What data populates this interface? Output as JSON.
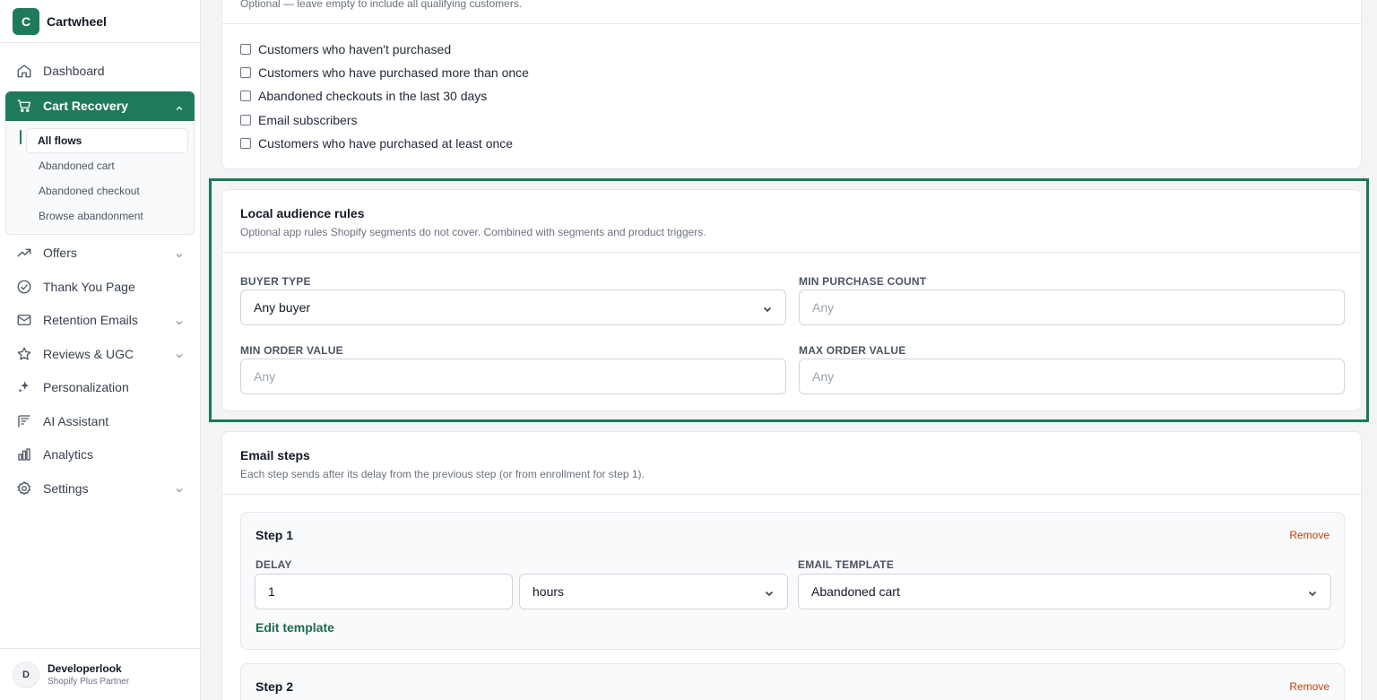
{
  "brand": {
    "logo_letter": "C",
    "name": "Cartwheel",
    "color": "#1f7a5c"
  },
  "sidebar": {
    "items": [
      {
        "label": "Dashboard",
        "icon": "home-icon"
      },
      {
        "label": "Cart Recovery",
        "icon": "cart-icon",
        "active": true
      },
      {
        "label": "Offers",
        "icon": "trending-up-icon"
      },
      {
        "label": "Thank You Page",
        "icon": "check-circle-icon"
      },
      {
        "label": "Retention Emails",
        "icon": "mail-icon"
      },
      {
        "label": "Reviews & UGC",
        "icon": "star-icon"
      },
      {
        "label": "Personalization",
        "icon": "sparkle-icon"
      },
      {
        "label": "AI Assistant",
        "icon": "ai-icon"
      },
      {
        "label": "Analytics",
        "icon": "bar-chart-icon"
      },
      {
        "label": "Settings",
        "icon": "gear-icon"
      }
    ],
    "sub_items": [
      "All flows",
      "Abandoned cart",
      "Abandoned checkout",
      "Browse abandonment"
    ]
  },
  "user": {
    "initial": "D",
    "name": "Developerlook",
    "role": "Shopify Plus Partner"
  },
  "segments": {
    "note": "Optional — leave empty to include all qualifying customers.",
    "options": [
      "Customers who haven't purchased",
      "Customers who have purchased more than once",
      "Abandoned checkouts in the last 30 days",
      "Email subscribers",
      "Customers who have purchased at least once"
    ]
  },
  "local_rules": {
    "title": "Local audience rules",
    "description": "Optional app rules Shopify segments do not cover. Combined with segments and product triggers.",
    "buyer_type_label": "BUYER TYPE",
    "buyer_type_value": "Any buyer",
    "min_purchase_label": "MIN PURCHASE COUNT",
    "min_purchase_placeholder": "Any",
    "min_order_label": "MIN ORDER VALUE",
    "min_order_placeholder": "Any",
    "max_order_label": "MAX ORDER VALUE",
    "max_order_placeholder": "Any"
  },
  "email_steps": {
    "title": "Email steps",
    "description": "Each step sends after its delay from the previous step (or from enrollment for step 1).",
    "steps": [
      {
        "title": "Step 1",
        "remove_label": "Remove",
        "delay_label": "DELAY",
        "delay_value": "1",
        "delay_unit": "hours",
        "template_label": "EMAIL TEMPLATE",
        "template_value": "Abandoned cart",
        "edit_label": "Edit template"
      },
      {
        "title": "Step 2",
        "remove_label": "Remove"
      }
    ]
  },
  "accent_highlight": "#1a7a57"
}
